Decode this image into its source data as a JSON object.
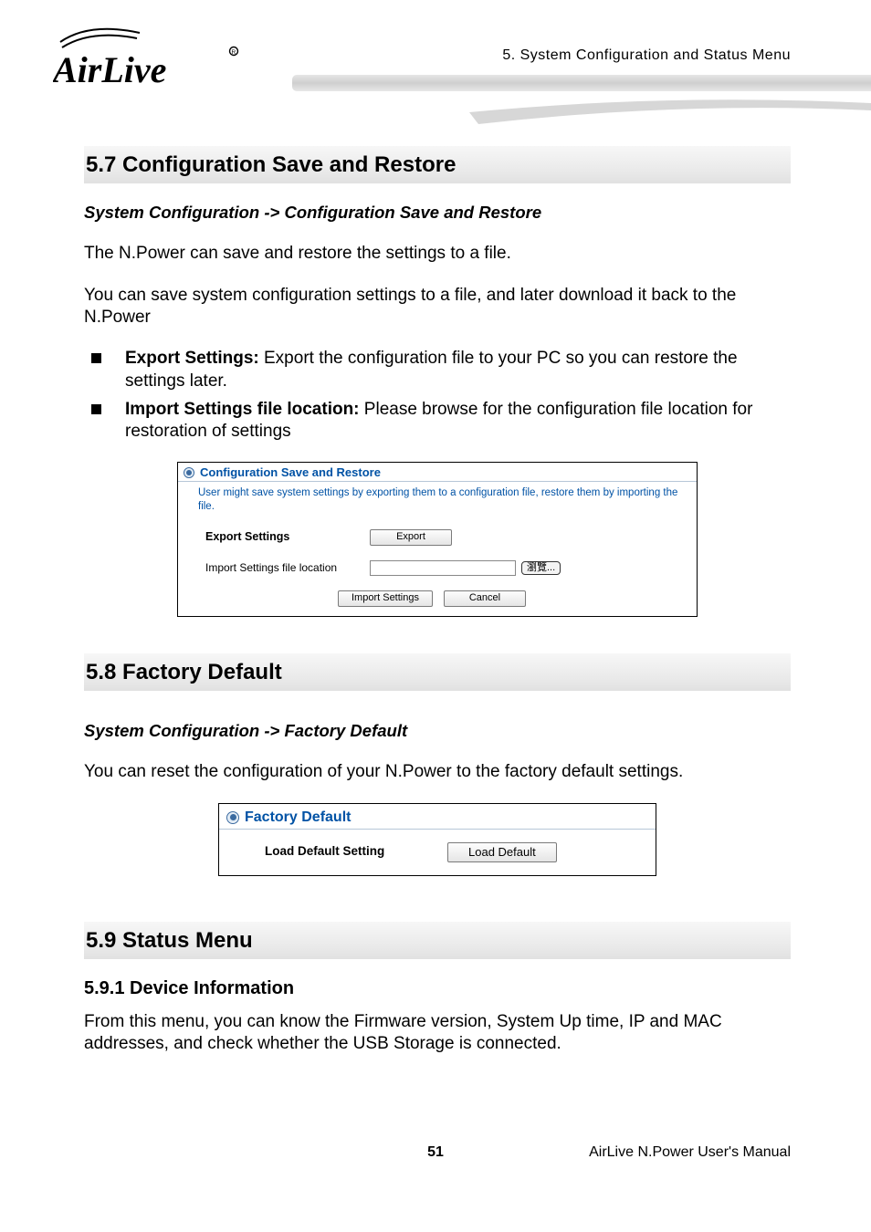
{
  "header": {
    "chapter": "5.  System  Configuration  and  Status  Menu",
    "logoText": "AirLive"
  },
  "sec57": {
    "title": "5.7 Configuration  Save  and  Restore",
    "breadcrumb": "System Configuration -> Configuration Save and Restore",
    "p1": "The N.Power can save and restore the settings to a file.",
    "p2": "You can save system configuration settings to a file, and later download it back to the N.Power",
    "bullet1_label": "Export Settings:",
    "bullet1_text": "   Export the configuration file to your PC so you can restore the settings later.",
    "bullet2_label": "Import Settings file location:",
    "bullet2_text": "   Please browse for the configuration file location for restoration of settings"
  },
  "ss1": {
    "title": "Configuration Save and Restore",
    "desc": "User might save system settings by exporting them to a configuration file, restore them by importing the file.",
    "exportLabel": "Export Settings",
    "exportBtn": "Export",
    "importLabel": "Import Settings file location",
    "browseBtn": "瀏覽...",
    "importSettingsBtn": "Import Settings",
    "cancelBtn": "Cancel"
  },
  "sec58": {
    "title": "5.8 Factory  Default",
    "breadcrumb": "System Configuration -> Factory Default",
    "p1": "You can reset the configuration of your N.Power to the factory default settings."
  },
  "ss2": {
    "title": "Factory Default",
    "label": "Load Default Setting",
    "btn": "Load Default"
  },
  "sec59": {
    "title": "5.9 Status  Menu",
    "sub": "5.9.1 Device Information",
    "p1": "From this menu, you can know the Firmware version, System Up time, IP and MAC addresses, and check whether the USB Storage is connected."
  },
  "footer": {
    "page": "51",
    "manual": "AirLive N.Power User's Manual"
  }
}
